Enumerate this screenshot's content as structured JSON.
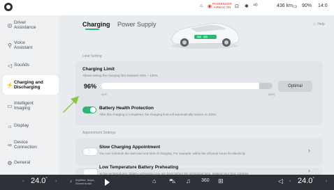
{
  "status_bar": {
    "airbag_line1": "PASSENGER",
    "airbag_line2": "AIRBAG ON",
    "range": "436 km",
    "battery": "90%",
    "time": "14:0"
  },
  "sidebar": {
    "items": [
      {
        "label": "Driver Assistance",
        "icon": "steering-wheel-icon",
        "active": false
      },
      {
        "label": "Voice Assistant",
        "icon": "microphone-icon",
        "active": false
      },
      {
        "label": "Sounds",
        "icon": "speaker-icon",
        "active": false
      },
      {
        "label": "Charging and Discharging",
        "icon": "plug-icon",
        "active": true
      },
      {
        "label": "Intelligent Imaging",
        "icon": "camera-icon",
        "active": false
      },
      {
        "label": "Display",
        "icon": "sun-icon",
        "active": false
      },
      {
        "label": "Device Connection",
        "icon": "link-icon",
        "active": false
      },
      {
        "label": "General",
        "icon": "gear-icon",
        "active": false
      }
    ]
  },
  "tabs": [
    {
      "label": "Charging",
      "active": true
    },
    {
      "label": "Power Supply",
      "active": false
    }
  ],
  "help_label": "Help",
  "limit_setting": {
    "section_title": "Limit Setting",
    "title": "Charging Limit",
    "subtitle": "Allows setting the charging limit between 50% ~ 100%",
    "value_label": "96%",
    "value": 96,
    "min_label": "50%",
    "max_label": "100%",
    "optimal_button": "Optimal",
    "health_title": "Battery Health Protection",
    "health_desc": "After this charging is completed, the charging limit will automatically restore to 100%",
    "health_on": true
  },
  "appointment": {
    "section_title": "Appointment Settings",
    "slow_title": "Slow Charging Appointment",
    "slow_desc": "You can schedule the start and end time of charging. For example, within the off-peak hours for electricity",
    "slow_on": false,
    "low_title": "Low Temperature Battery Preheating",
    "low_desc": "At low temperatures, battery preheating can get done before the scheduled time, making your trips carefree",
    "low_on": false
  },
  "bottom_bar": {
    "left_temp": "24.0",
    "right_temp": "24.0",
    "degree": "°",
    "media_line1": "Anytime, Anyw...",
    "media_line2": "Stored Audio",
    "fan_label": "360"
  },
  "colors": {
    "accent": "#2bb673",
    "arrow": "#8cc63f",
    "bottom_bar": "#2e3238"
  }
}
